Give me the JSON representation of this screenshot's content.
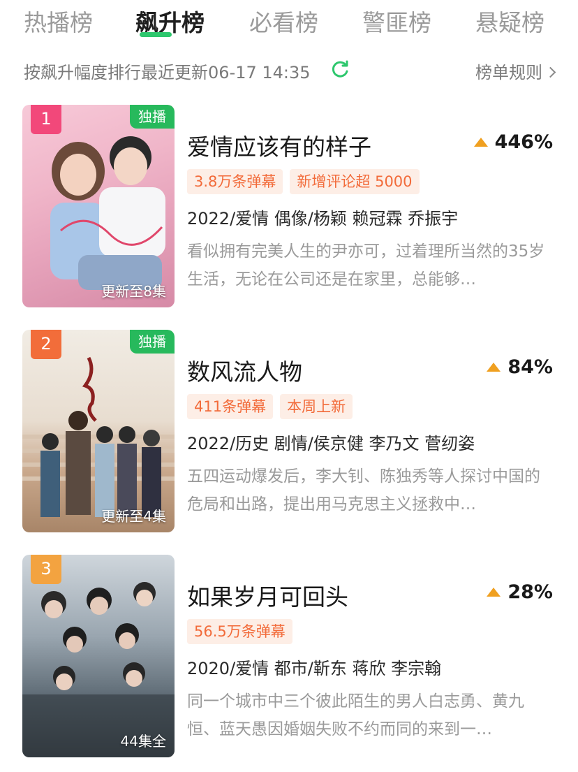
{
  "tabs": [
    {
      "label": "热播榜"
    },
    {
      "label": "飙升榜"
    },
    {
      "label": "必看榜"
    },
    {
      "label": "警匪榜"
    },
    {
      "label": "悬疑榜"
    }
  ],
  "active_tab_index": 1,
  "colors": {
    "accent": "#2dc76d",
    "exclusive_badge": "#27b95c",
    "tag_bg": "#fdeee6",
    "tag_text": "#f26b3a",
    "trend_up": "#f0a020",
    "rank1": "#f2487a",
    "rank2": "#f26d3a",
    "rank3": "#f3a340"
  },
  "subheader": {
    "sort_text": "按飙升幅度排行最近更新06-17 14:35",
    "refresh_icon": "refresh-icon",
    "rules_label": "榜单规则"
  },
  "items": [
    {
      "rank": "1",
      "badge": "独播",
      "update": "更新至8集",
      "title": "爱情应该有的样子",
      "trend": "446%",
      "tags": [
        "3.8万条弹幕",
        "新增评论超 5000"
      ],
      "meta": "2022/爱情 偶像/杨颖 赖冠霖 乔振宇",
      "desc": "看似拥有完美人生的尹亦可，过着理所当然的35岁生活，无论在公司还是在家里，总能够…"
    },
    {
      "rank": "2",
      "badge": "独播",
      "update": "更新至4集",
      "title": "数风流人物",
      "trend": "84%",
      "tags": [
        "411条弹幕",
        "本周上新"
      ],
      "meta": "2022/历史 剧情/侯京健 李乃文 菅纫姿",
      "desc": "五四运动爆发后，李大钊、陈独秀等人探讨中国的危局和出路，提出用马克思主义拯救中…"
    },
    {
      "rank": "3",
      "badge": "",
      "update": "44集全",
      "title": "如果岁月可回头",
      "trend": "28%",
      "tags": [
        "56.5万条弹幕"
      ],
      "meta": "2020/爱情 都市/靳东 蒋欣 李宗翰",
      "desc": "同一个城市中三个彼此陌生的男人白志勇、黄九恒、蓝天愚因婚姻失败不约而同的来到一…"
    }
  ]
}
